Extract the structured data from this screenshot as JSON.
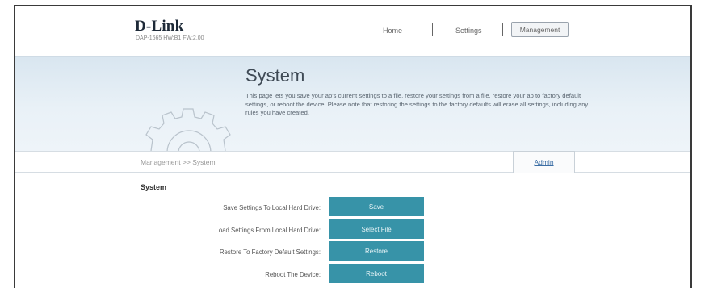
{
  "header": {
    "logo": "D-Link",
    "model": "DAP-1665 HW:B1 FW:2.00",
    "nav": [
      {
        "label": "Home"
      },
      {
        "label": "Settings"
      },
      {
        "label": "Management"
      }
    ]
  },
  "banner": {
    "title": "System",
    "description": "This page lets you save your ap's current settings to a file, restore your settings from a file, restore your ap to factory default settings, or reboot the device. Please note that restoring the settings to the factory defaults will erase all settings, including any rules you have created."
  },
  "breadcrumb": {
    "path": "Management >> System",
    "tab": "Admin"
  },
  "section": {
    "title": "System",
    "rows": [
      {
        "label": "Save Settings To Local Hard Drive:",
        "button": "Save"
      },
      {
        "label": "Load Settings From Local Hard Drive:",
        "button": "Select File"
      },
      {
        "label": "Restore To Factory Default Settings:",
        "button": "Restore"
      },
      {
        "label": "Reboot The Device:",
        "button": "Reboot"
      }
    ]
  },
  "colors": {
    "button": "#3793a8",
    "banner": "#e3edf5",
    "link": "#3b6ea5"
  }
}
